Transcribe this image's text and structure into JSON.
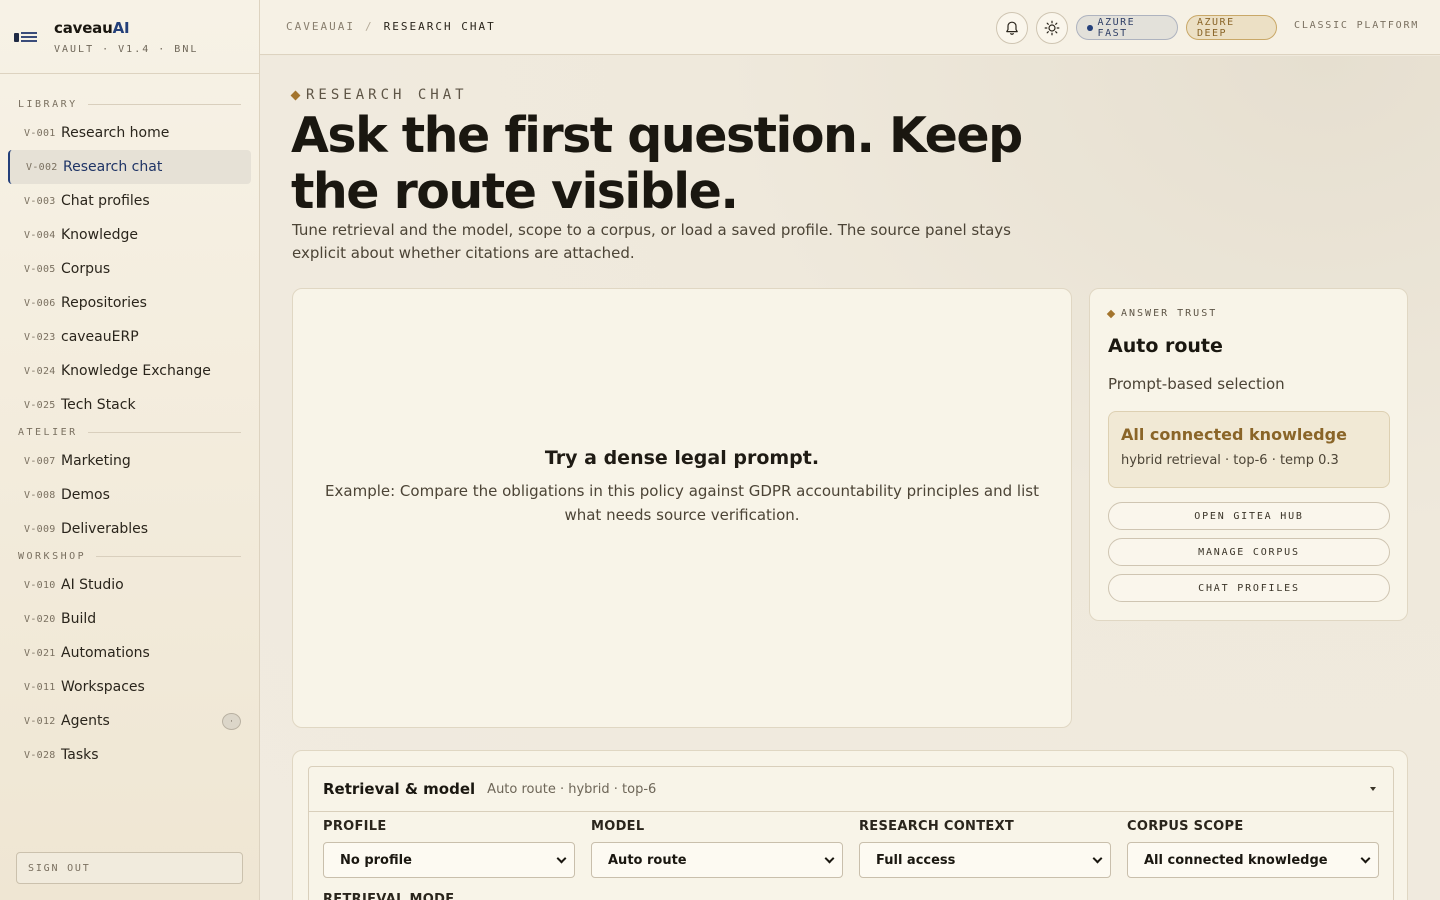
{
  "brand": {
    "name": "caveau",
    "name_ai": "AI",
    "sub": "VAULT · V1.4 · BNL"
  },
  "sidebar": {
    "sections": [
      {
        "label": "LIBRARY"
      },
      {
        "label": "ATELIER"
      },
      {
        "label": "WORKSHOP"
      }
    ],
    "library": [
      {
        "code": "V-001",
        "label": "Research home"
      },
      {
        "code": "V-002",
        "label": "Research chat"
      },
      {
        "code": "V-003",
        "label": "Chat profiles"
      },
      {
        "code": "V-004",
        "label": "Knowledge"
      },
      {
        "code": "V-005",
        "label": "Corpus"
      },
      {
        "code": "V-006",
        "label": "Repositories"
      },
      {
        "code": "V-023",
        "label": "caveauERP"
      },
      {
        "code": "V-024",
        "label": "Knowledge Exchange"
      },
      {
        "code": "V-025",
        "label": "Tech Stack"
      }
    ],
    "atelier": [
      {
        "code": "V-007",
        "label": "Marketing"
      },
      {
        "code": "V-008",
        "label": "Demos"
      },
      {
        "code": "V-009",
        "label": "Deliverables"
      }
    ],
    "workshop": [
      {
        "code": "V-010",
        "label": "AI Studio"
      },
      {
        "code": "V-020",
        "label": "Build"
      },
      {
        "code": "V-021",
        "label": "Automations"
      },
      {
        "code": "V-011",
        "label": "Workspaces"
      },
      {
        "code": "V-012",
        "label": "Agents",
        "badge": "·"
      },
      {
        "code": "V-028",
        "label": "Tasks"
      }
    ],
    "signout": "SIGN OUT"
  },
  "topbar": {
    "crumb_root": "CAVEAUAI",
    "crumb_sep": "/",
    "crumb_current": "RESEARCH CHAT",
    "azure_fast": "AZURE FAST",
    "azure_deep": "AZURE DEEP",
    "classic": "CLASSIC PLATFORM"
  },
  "hero": {
    "eyebrow": "RESEARCH CHAT",
    "headline": "Ask the first question. Keep the route visible.",
    "lead": "Tune retrieval and the model, scope to a corpus, or load a saved profile. The source panel stays explicit about whether citations are attached."
  },
  "chat": {
    "empty_title": "Try a dense legal prompt.",
    "empty_body": "Example: Compare the obligations in this policy against GDPR accountability principles and list what needs source verification."
  },
  "trust": {
    "eyebrow": "ANSWER TRUST",
    "title": "Auto route",
    "subtitle": "Prompt-based selection",
    "box_title": "All connected knowledge",
    "box_detail": "hybrid retrieval · top-6 · temp 0.3",
    "btn_gitea": "OPEN GITEA HUB",
    "btn_corpus": "MANAGE CORPUS",
    "btn_profiles": "CHAT PROFILES"
  },
  "retrieval": {
    "title": "Retrieval & model",
    "summary": "Auto route · hybrid · top-6",
    "profile_label": "PROFILE",
    "profile_value": "No profile",
    "model_label": "MODEL",
    "model_value": "Auto route",
    "context_label": "RESEARCH CONTEXT",
    "context_value": "Full access",
    "scope_label": "CORPUS SCOPE",
    "scope_value": "All connected knowledge",
    "mode_label": "RETRIEVAL MODE"
  },
  "colors": {
    "accent": "#24407a",
    "gold": "#a3742d",
    "background": "#efe9dc"
  }
}
